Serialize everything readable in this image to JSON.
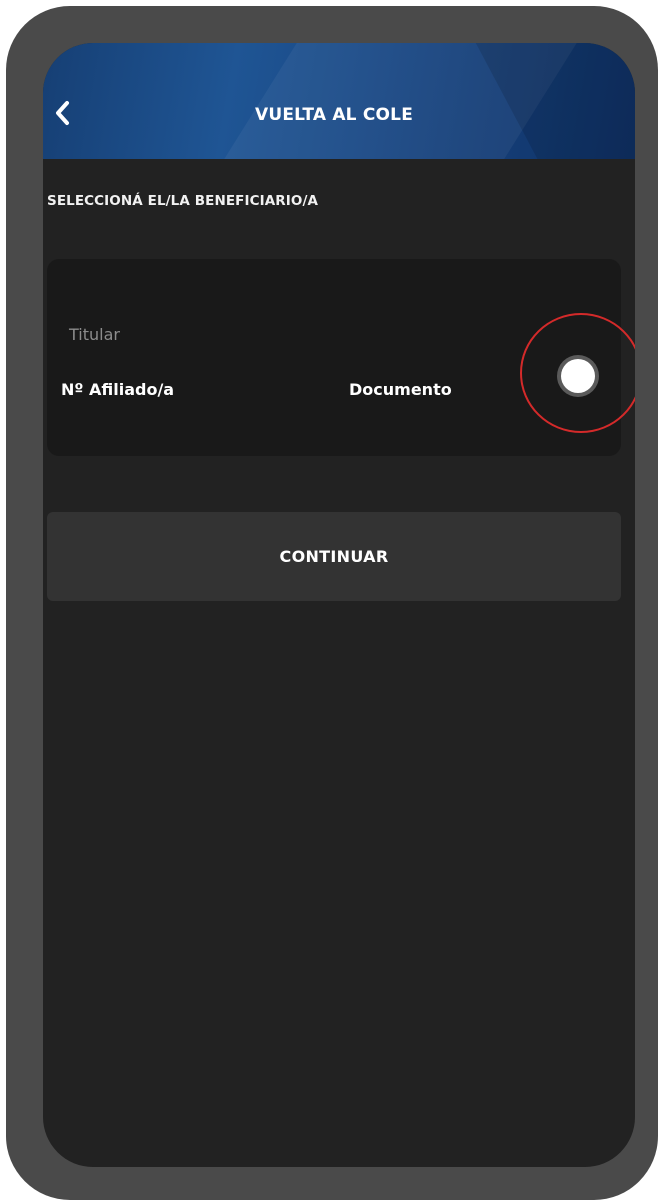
{
  "header": {
    "title": "VUELTA AL COLE",
    "back_icon": "chevron-left-icon",
    "gradient_colors": [
      "#163f74",
      "#1f5594",
      "#0f3165"
    ]
  },
  "main": {
    "section_label": "SELECCIONÁ EL/LA BENEFICIARIO/A",
    "card": {
      "tag": "Titular",
      "affiliate_label": "Nº Afiliado/a",
      "document_label": "Documento",
      "radio_selected": true
    },
    "continue_label": "CONTINUAR"
  },
  "colors": {
    "background": "#222222",
    "card": "#191919",
    "button": "#333333",
    "highlight": "#d42a2a"
  }
}
